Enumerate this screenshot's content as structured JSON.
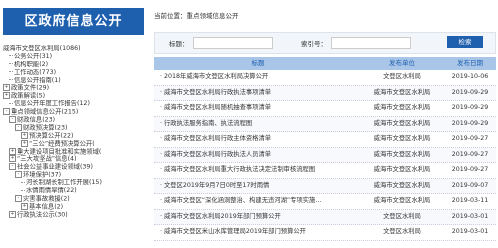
{
  "sidebar": {
    "title": "区政府信息公开",
    "tree": [
      {
        "indent": 0,
        "marker": "",
        "label": "威海市文登区水利局(1086)"
      },
      {
        "indent": 1,
        "marker": "line",
        "label": "公务公开(31)"
      },
      {
        "indent": 1,
        "marker": "line",
        "label": "机构职能(2)"
      },
      {
        "indent": 1,
        "marker": "line",
        "label": "工作动态(773)"
      },
      {
        "indent": 1,
        "marker": "line",
        "label": "信息公开指南(1)"
      },
      {
        "indent": 0,
        "marker": "+",
        "label": "政策文件(29)"
      },
      {
        "indent": 0,
        "marker": "+",
        "label": "政策解读(5)"
      },
      {
        "indent": 1,
        "marker": "line",
        "label": "信息公开年度工作报告(12)"
      },
      {
        "indent": 0,
        "marker": "-",
        "label": "重点领域信息公开(215)"
      },
      {
        "indent": 1,
        "marker": "-",
        "label": "财政信息(23)"
      },
      {
        "indent": 2,
        "marker": "-",
        "label": "财政预决算(23)"
      },
      {
        "indent": 3,
        "marker": "+",
        "label": "预决算公开(22)"
      },
      {
        "indent": 3,
        "marker": "+",
        "label": "“三公”经费预决算公开("
      },
      {
        "indent": 1,
        "marker": "+",
        "label": "重大建设项目批准和实施领域("
      },
      {
        "indent": 1,
        "marker": "+",
        "label": "“三大攻坚战”信息(4)"
      },
      {
        "indent": 1,
        "marker": "-",
        "label": "社会公益事业建设领域(39)"
      },
      {
        "indent": 2,
        "marker": "-",
        "label": "环境保护(37)"
      },
      {
        "indent": 3,
        "marker": "line",
        "label": "河长制湖长制工作开展(15)"
      },
      {
        "indent": 3,
        "marker": "line",
        "label": "水情雨情旱情(22)"
      },
      {
        "indent": 2,
        "marker": "-",
        "label": "灾害事故救援(2)"
      },
      {
        "indent": 3,
        "marker": "+",
        "label": "基本信息(2)"
      },
      {
        "indent": 1,
        "marker": "+",
        "label": "行政执法公示(30)"
      }
    ]
  },
  "breadcrumb": "当前位置：重点领域信息公开",
  "search": {
    "title_label": "标题：",
    "title_value": "",
    "index_label": "索引号：",
    "index_value": "",
    "button_label": "检索"
  },
  "table": {
    "headers": [
      "标题",
      "发布单位",
      "发布日期"
    ],
    "rows": [
      [
        "· 2018年威海市文登区水利局决算公开",
        "文登区水利局",
        "2019-10-06"
      ],
      [
        "· 威海市文登区水利局行政执法事项清单",
        "威海市文登区水利局",
        "2019-09-29"
      ],
      [
        "· 威海市文登区水利局随机抽查事项清单",
        "威海市文登区水利局",
        "2019-09-29"
      ],
      [
        "· 行政执法服务指南、执法流程图",
        "威海市文登区水利局",
        "2019-09-29"
      ],
      [
        "· 威海市文登区水利局行政主体资格清单",
        "威海市文登区水利局",
        "2019-09-27"
      ],
      [
        "· 威海市文登区水利局行政执法人员清单",
        "威海市文登区水利局",
        "2019-09-27"
      ],
      [
        "· 威海市文登区水利局重大行政执法决定法制审核流程图",
        "威海市文登区水利局",
        "2019-09-27"
      ],
      [
        "· 文登区2019年9月7日0时至17时雨情",
        "威海市文登区水利局",
        "2019-09-07"
      ],
      [
        "· 威海市文登区“深化涵洞整治、构建无违河湖”专项实施...",
        "威海市文登区水利局",
        "2019-03-11"
      ],
      [
        "· 威海市文登区水利局2019年部门预算公开",
        "文登区水利局",
        "2019-03-01"
      ],
      [
        "· 威海市文登区米山水库管理局2019年部门预算公开",
        "文登区水利局",
        "2019-03-01"
      ]
    ]
  }
}
